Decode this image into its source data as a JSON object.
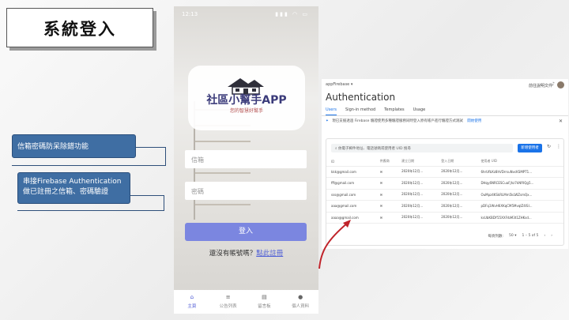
{
  "slide": {
    "title": "系統登入",
    "callout1": "信箱密碼防呆除錯功能",
    "callout2_line1": "串接Firebase Authentication",
    "callout2_line2": "做已註冊之信箱、密碼驗證"
  },
  "phone": {
    "status_time": "12:13",
    "status_indicators": "▮▮▮ ◠ ▭",
    "app_title": "社區小幫手APP",
    "app_subtitle": "您的智慧好幫手",
    "email_placeholder": "信箱",
    "password_placeholder": "密碼",
    "login_label": "登入",
    "signup_prompt": "還沒有帳號嗎？",
    "signup_link": "點此註冊",
    "tabs": [
      {
        "label": "主頁",
        "icon": "home-icon",
        "glyph": "⌂"
      },
      {
        "label": "公告列表",
        "icon": "list-icon",
        "glyph": "≡"
      },
      {
        "label": "留言板",
        "icon": "board-icon",
        "glyph": "▤"
      },
      {
        "label": "個人資料",
        "icon": "person-icon",
        "glyph": "●"
      }
    ]
  },
  "firebase": {
    "project": "appFirebase ▾",
    "docs_link": "前往說明文件",
    "title": "Authentication",
    "tabs": [
      "Users",
      "Sign-in method",
      "Templates",
      "Usage"
    ],
    "banner_text": "現已支援透過 Firebase 驗證使用多種驗證服務同時登入原有帳戶進行驗證方式測試",
    "banner_learn": "開始使用",
    "search_placeholder": "依電子郵件地址、電話號碼或使用者 UID 搜尋",
    "add_user_label": "新增使用者",
    "columns": [
      "ID",
      "供應商",
      "建立日期",
      "登入日期",
      "使用者 UID"
    ],
    "rows": [
      {
        "id": "kkk@gmail.com",
        "provider": "✉",
        "created": "2020年12月...",
        "signed_in": "2020年12月...",
        "uid": "6hrUfbXz8hVDrrsuNvcKSMPT1..."
      },
      {
        "id": "fff@gmail.com",
        "provider": "✉",
        "created": "2020年12月...",
        "signed_in": "2020年12月...",
        "uid": "DHqy6NRCESCuaFjhz7kNfXQg5..."
      },
      {
        "id": "sss@gmail.com",
        "provider": "✉",
        "created": "2020年12月...",
        "signed_in": "2020年12月...",
        "uid": "OuMpz4KSkRLMm5kLWZsmQx..."
      },
      {
        "id": "aaa@gmail.com",
        "provider": "✉",
        "created": "2020年12月...",
        "signed_in": "2020年12月...",
        "uid": "pDFq1WvH6XKqCM5MvqIZ4ISl..."
      },
      {
        "id": "aaaa@gmail.com",
        "provider": "✉",
        "created": "2020年12月...",
        "signed_in": "2020年12月...",
        "uid": "ksUbKBDY55XXFrbM3t1ZHKsd..."
      }
    ],
    "rows_per_page_label": "每頁列數:",
    "rows_per_page": "50 ▾",
    "page_range": "1 – 5 of 5",
    "prev": "‹",
    "next": "›"
  }
}
